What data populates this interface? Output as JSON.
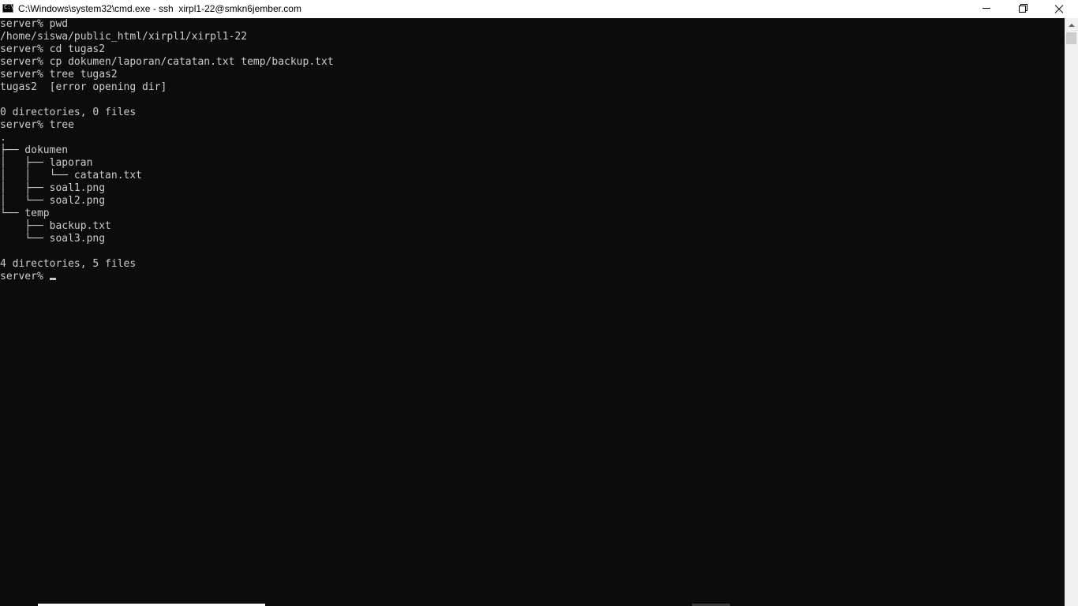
{
  "window": {
    "title": "C:\\Windows\\system32\\cmd.exe - ssh  xirpl1-22@smkn6jember.com",
    "icon_label": "C:\\"
  },
  "console": {
    "lines": [
      "server% pwd",
      "/home/siswa/public_html/xirpl1/xirpl1-22",
      "server% cd tugas2",
      "server% cp dokumen/laporan/catatan.txt temp/backup.txt",
      "server% tree tugas2",
      "tugas2  [error opening dir]",
      "",
      "0 directories, 0 files",
      "server% tree",
      ".",
      "├── dokumen",
      "│   ├── laporan",
      "│   │   └── catatan.txt",
      "│   ├── soal1.png",
      "│   └── soal2.png",
      "└── temp",
      "    ├── backup.txt",
      "    └── soal3.png",
      "",
      "4 directories, 5 files"
    ],
    "prompt": "server% "
  },
  "colors": {
    "background": "#0c0c0c",
    "foreground": "#cccccc",
    "titlebar": "#ffffff"
  },
  "icons": {
    "app": "cmd-icon",
    "minimize": "minimize-icon",
    "restore": "restore-icon",
    "close": "close-icon"
  }
}
